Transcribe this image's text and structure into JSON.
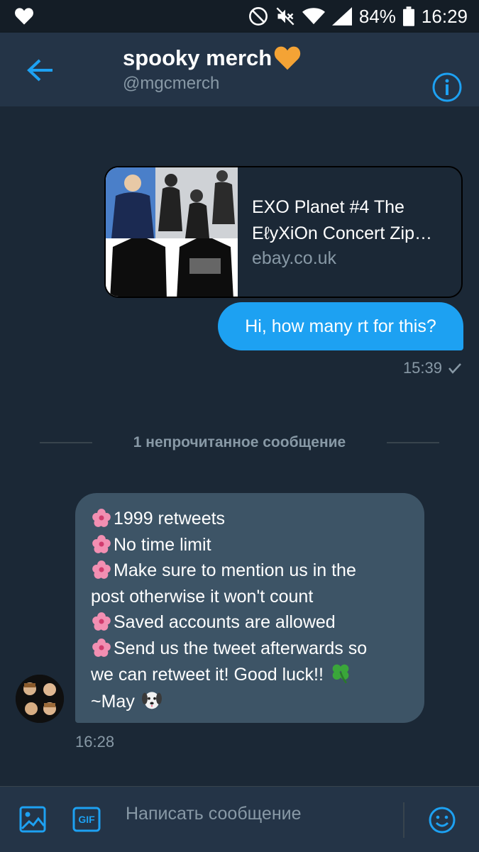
{
  "status_bar": {
    "battery": "84%",
    "time": "16:29",
    "icons": [
      "heart-icon",
      "do-not-disturb-icon",
      "mute-icon",
      "wifi-icon",
      "signal-icon",
      "battery-icon"
    ]
  },
  "header": {
    "title": "spooky merch",
    "title_emoji": "orange-heart",
    "handle": "@mgcmerch"
  },
  "messages": {
    "link_card": {
      "title": "EXO Planet #4 The EℓyXiOn Concert Zip…",
      "domain": "ebay.co.uk"
    },
    "outgoing": {
      "text": "Hi, how many rt for this?",
      "time": "15:39"
    },
    "unread_divider": "1 непрочитанное сообщение",
    "incoming": {
      "lines": [
        "1999 retweets",
        "No time limit",
        "Make sure to mention us in the",
        "post otherwise it won't count",
        "Saved accounts are allowed",
        "Send us the tweet afterwards so",
        "we can retweet it! Good luck!!",
        "~May"
      ],
      "time": "16:28"
    }
  },
  "composer": {
    "placeholder": "Написать сообщение",
    "gif_label": "GIF"
  },
  "colors": {
    "background": "#141d26",
    "header": "#243447",
    "accent": "#1da1f2",
    "incoming_bubble": "#3d5466",
    "secondary_text": "#8899a6"
  }
}
